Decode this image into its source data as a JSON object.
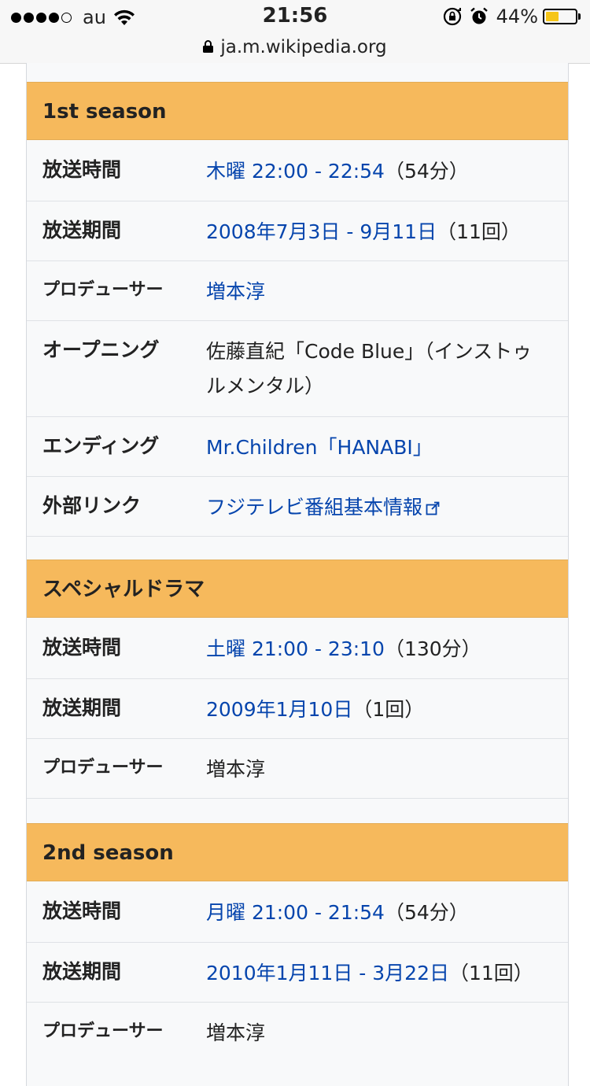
{
  "status_bar": {
    "carrier": "au",
    "time": "21:56",
    "battery_percent": "44%",
    "battery_level": 0.44,
    "signal_bars_filled": 4,
    "signal_bars_total": 5
  },
  "url_bar": {
    "domain": "ja.m.wikipedia.org",
    "icon": "lock-icon"
  },
  "colors": {
    "section_header": "#f6b95c",
    "link": "#0645ad",
    "infobox_bg": "#f8f9fa"
  },
  "sections": [
    {
      "title": "1st season",
      "rows": [
        {
          "label": "放送時間",
          "value_link": "木曜 22:00 - 22:54",
          "value_suffix": "（54分）"
        },
        {
          "label": "放送期間",
          "value_link": "2008年7月3日 - 9月11日",
          "value_suffix": "（11回）"
        },
        {
          "label": "プロデューサー",
          "value_link": "増本淳",
          "value_suffix": ""
        },
        {
          "label": "オープニング",
          "value_text": "佐藤直紀「Code Blue」（インストゥルメンタル）"
        },
        {
          "label": "エンディング",
          "value_link": "Mr.Children「HANABI」",
          "value_suffix": ""
        },
        {
          "label": "外部リンク",
          "value_link": "フジテレビ番組基本情報",
          "value_suffix": "",
          "icon": "external-link-icon"
        }
      ]
    },
    {
      "title": "スペシャルドラマ",
      "rows": [
        {
          "label": "放送時間",
          "value_link": "土曜 21:00 - 23:10",
          "value_suffix": "（130分）"
        },
        {
          "label": "放送期間",
          "value_link": "2009年1月10日",
          "value_suffix": "（1回）"
        },
        {
          "label": "プロデューサー",
          "value_text": "増本淳"
        }
      ]
    },
    {
      "title": "2nd season",
      "rows": [
        {
          "label": "放送時間",
          "value_link": "月曜 21:00 - 21:54",
          "value_suffix": "（54分）"
        },
        {
          "label": "放送期間",
          "value_link": "2010年1月11日 - 3月22日",
          "value_suffix": "（11回）"
        },
        {
          "label": "プロデューサー",
          "value_text": "増本淳"
        }
      ]
    }
  ]
}
